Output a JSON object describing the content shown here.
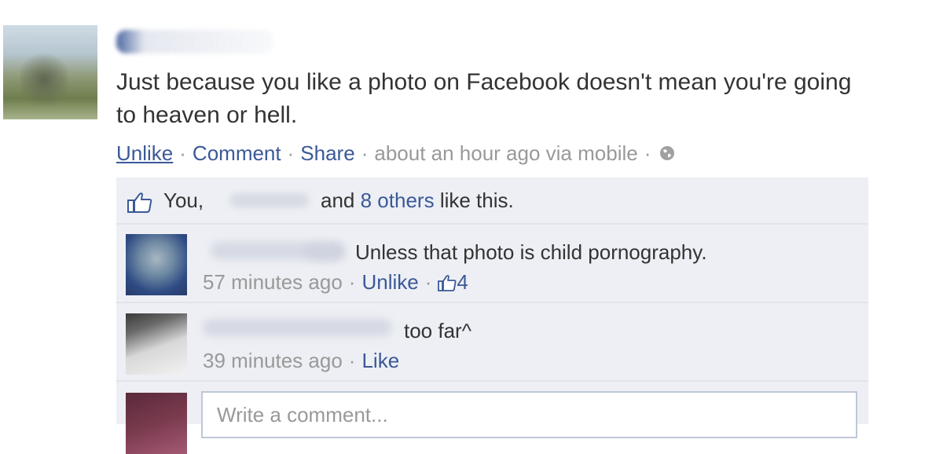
{
  "post": {
    "text": "Just because you like a photo on Facebook doesn't mean you're going to heaven or hell.",
    "actions": {
      "unlike": "Unlike",
      "comment": "Comment",
      "share": "Share",
      "timestamp": "about an hour ago via mobile",
      "separator": "·"
    }
  },
  "likes": {
    "prefix": "You,",
    "middle": "and",
    "others_link": "8 others",
    "suffix": "like this."
  },
  "comments": [
    {
      "text": "Unless that photo is child pornography.",
      "time": "57 minutes ago",
      "action": "Unlike",
      "like_count": "4"
    },
    {
      "text": "too far^",
      "time": "39 minutes ago",
      "action": "Like"
    }
  ],
  "composer": {
    "placeholder": "Write a comment..."
  },
  "colors": {
    "link": "#3b5998",
    "muted": "#999999",
    "ufi_bg": "#edeff4"
  }
}
